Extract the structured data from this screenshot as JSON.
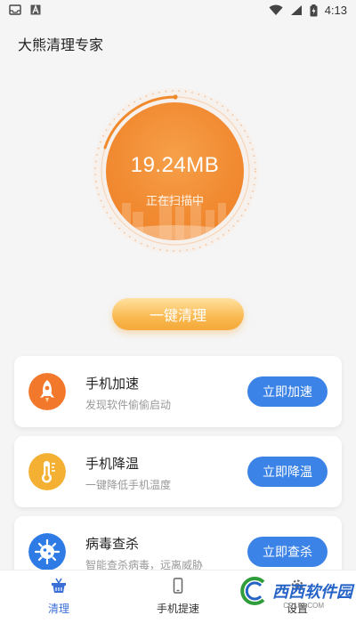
{
  "status_bar": {
    "time": "4:13",
    "icons": [
      "inbox-icon",
      "a-icon",
      "wifi-icon",
      "signal-icon",
      "battery-icon"
    ]
  },
  "app": {
    "title": "大熊清理专家"
  },
  "scan": {
    "value": "19.24MB",
    "status": "正在扫描中"
  },
  "clean_button": {
    "label": "一键清理"
  },
  "cards": [
    {
      "icon": "rocket-icon",
      "title": "手机加速",
      "desc": "发现软件偷偷启动",
      "button": "立即加速",
      "color": "#f2792b"
    },
    {
      "icon": "thermometer-icon",
      "title": "手机降温",
      "desc": "一键降低手机温度",
      "button": "立即降温",
      "color": "#f4b032"
    },
    {
      "icon": "virus-icon",
      "title": "病毒查杀",
      "desc": "智能查杀病毒，远离威胁",
      "button": "立即查杀",
      "color": "#2f7be6"
    }
  ],
  "tabs": [
    {
      "label": "清理",
      "icon": "basket-icon",
      "active": true
    },
    {
      "label": "手机提速",
      "icon": "phone-icon",
      "active": false
    },
    {
      "label": "设置",
      "icon": "gear-icon",
      "active": false
    }
  ],
  "watermark": {
    "text": "西西软件园",
    "sub": "CR173.COM"
  },
  "colors": {
    "accent_orange": "#f18b32",
    "button_blue": "#3b83e6",
    "tab_active": "#3b6fd8"
  }
}
